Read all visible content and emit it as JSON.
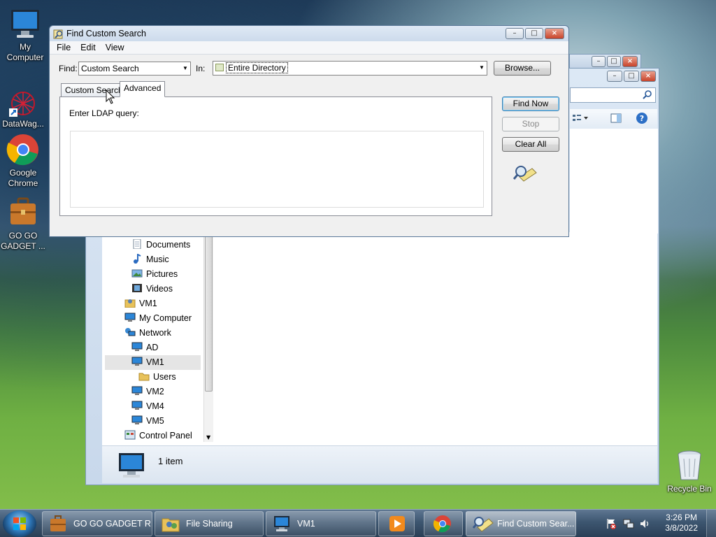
{
  "desktop": {
    "icons": [
      {
        "label": "My\nComputer",
        "name": "my-computer"
      },
      {
        "label": "DataWag...",
        "name": "datawag"
      },
      {
        "label": "Google\nChrome",
        "name": "google-chrome"
      },
      {
        "label": "GO GO\nGADGET ...",
        "name": "go-go-gadget"
      },
      {
        "label": "Recycle Bin",
        "name": "recycle-bin"
      }
    ]
  },
  "explorer": {
    "nav_items": [
      {
        "label": "Documents",
        "icon": "documents-icon"
      },
      {
        "label": "Music",
        "icon": "music-icon"
      },
      {
        "label": "Pictures",
        "icon": "pictures-icon"
      },
      {
        "label": "Videos",
        "icon": "videos-icon"
      },
      {
        "label": "VM1",
        "icon": "user-folder-icon"
      },
      {
        "label": "My Computer",
        "icon": "computer-icon"
      },
      {
        "label": "Network",
        "icon": "network-icon"
      },
      {
        "label": "AD",
        "icon": "computer-icon"
      },
      {
        "label": "VM1",
        "icon": "computer-icon",
        "selected": true
      },
      {
        "label": "Users",
        "icon": "folder-icon"
      },
      {
        "label": "VM2",
        "icon": "computer-icon"
      },
      {
        "label": "VM4",
        "icon": "computer-icon"
      },
      {
        "label": "VM5",
        "icon": "computer-icon"
      },
      {
        "label": "Control Panel",
        "icon": "control-panel-icon"
      }
    ],
    "status": {
      "count": "1 item"
    }
  },
  "dialog": {
    "title": "Find Custom Search",
    "menu": [
      "File",
      "Edit",
      "View"
    ],
    "find_label": "Find:",
    "find_value": "Custom Search",
    "in_label": "In:",
    "in_value": "Entire Directory",
    "browse": "Browse...",
    "tabs": [
      "Custom Search",
      "Advanced"
    ],
    "active_tab": "Advanced",
    "query_label": "Enter LDAP query:",
    "query_value": "",
    "buttons": {
      "find_now": "Find Now",
      "stop": "Stop",
      "clear_all": "Clear All"
    }
  },
  "taskbar": {
    "tasks": [
      {
        "label": "GO GO GADGET R...",
        "icon": "briefcase-icon"
      },
      {
        "label": "File Sharing",
        "icon": "file-sharing-icon"
      },
      {
        "label": "VM1",
        "icon": "computer-icon"
      },
      {
        "label": "",
        "icon": "media-player-icon"
      },
      {
        "label": "",
        "icon": "chrome-icon"
      },
      {
        "label": "Find Custom Sear...",
        "icon": "find-icon",
        "active": true
      }
    ],
    "time": "3:26 PM",
    "date": "3/8/2022"
  },
  "colors": {
    "accent": "#3c7fb1",
    "selection": "#e5e5e5",
    "taskbar": "#3d5670"
  }
}
